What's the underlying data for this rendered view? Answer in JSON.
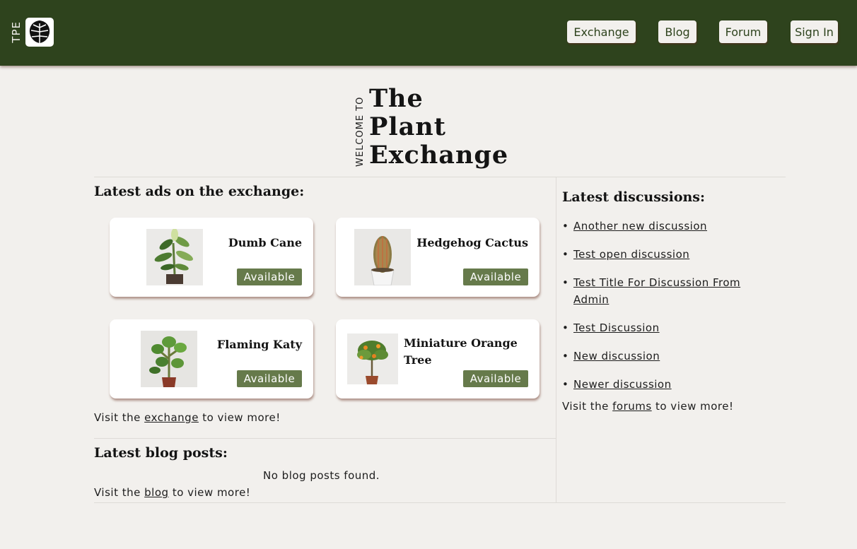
{
  "brand": {
    "abbr": "TPE",
    "logo_icon": "monstera-leaf-icon"
  },
  "nav": {
    "exchange": "Exchange",
    "blog": "Blog",
    "forum": "Forum",
    "sign_in": "Sign In"
  },
  "hero": {
    "welcome": "WELCOME TO",
    "title_line1": "The",
    "title_line2": "Plant",
    "title_line3": "Exchange"
  },
  "ads": {
    "heading": "Latest ads on the exchange:",
    "items": [
      {
        "name": "Dumb Cane",
        "status": "Available",
        "image": "dumb-cane-plant-photo"
      },
      {
        "name": "Hedgehog Cactus",
        "status": "Available",
        "image": "hedgehog-cactus-photo"
      },
      {
        "name": "Flaming Katy",
        "status": "Available",
        "image": "flaming-katy-plant-photo"
      },
      {
        "name": "Miniature Orange Tree",
        "status": "Available",
        "image": "miniature-orange-tree-photo"
      }
    ],
    "footer_prefix": "Visit the",
    "footer_link": "exchange",
    "footer_suffix": "to view more!"
  },
  "blog": {
    "heading": "Latest blog posts:",
    "empty": "No blog posts found.",
    "footer_prefix": "Visit the",
    "footer_link": "blog",
    "footer_suffix": "to view more!"
  },
  "discussions": {
    "heading": "Latest discussions:",
    "items": [
      "Another new discussion",
      "Test open discussion",
      "Test Title For Discussion From Admin",
      "Test Discussion",
      "New discussion",
      "Newer discussion"
    ],
    "footer_prefix": "Visit the",
    "footer_link": "forums",
    "footer_suffix": "to view more!"
  },
  "colors": {
    "header_bg": "#2e431d",
    "page_bg": "#f2f0ed",
    "badge_bg": "#667a4b"
  }
}
